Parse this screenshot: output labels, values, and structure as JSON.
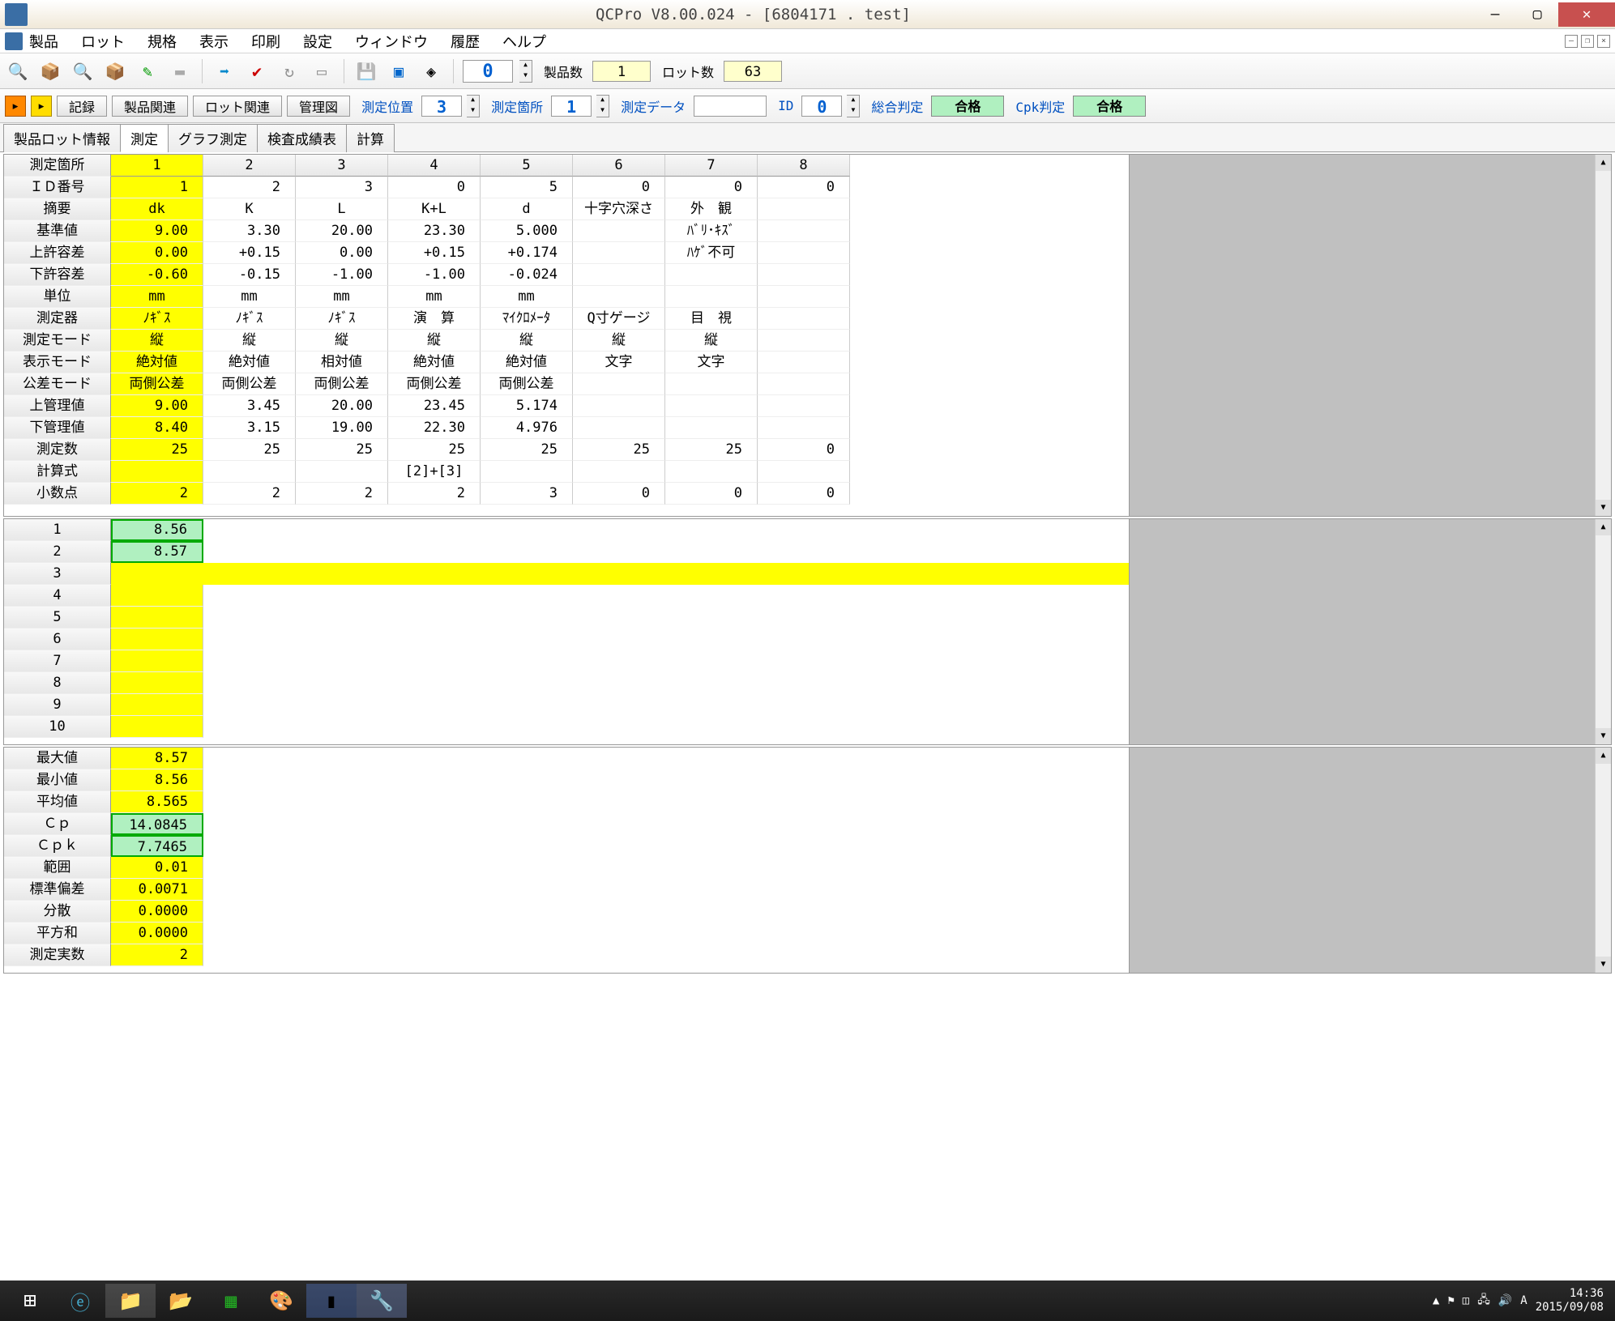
{
  "title": "QCPro V8.00.024 - [6804171  .  test]",
  "menu": [
    "製品",
    "ロット",
    "規格",
    "表示",
    "印刷",
    "設定",
    "ウィンドウ",
    "履歴",
    "ヘルプ"
  ],
  "toolbar1": {
    "counter": "0",
    "label_products": "製品数",
    "val_products": "1",
    "label_lots": "ロット数",
    "val_lots": "63"
  },
  "toolbar2": {
    "btns": [
      "記録",
      "製品関連",
      "ロット関連",
      "管理図"
    ],
    "lbl_pos": "測定位置",
    "val_pos": "3",
    "lbl_place": "測定箇所",
    "val_place": "1",
    "lbl_data": "測定データ",
    "lbl_id": "ID",
    "val_id": "0",
    "lbl_overall": "総合判定",
    "val_overall": "合格",
    "lbl_cpk": "Cpk判定",
    "val_cpk": "合格"
  },
  "tabs": [
    "製品ロット情報",
    "測定",
    "グラフ測定",
    "検査成績表",
    "計算"
  ],
  "spec": {
    "rowheaders": [
      "測定箇所",
      "ＩＤ番号",
      "摘要",
      "基準値",
      "上許容差",
      "下許容差",
      "単位",
      "測定器",
      "測定モード",
      "表示モード",
      "公差モード",
      "上管理値",
      "下管理値",
      "測定数",
      "計算式",
      "小数点"
    ],
    "cols": [
      [
        "1",
        "1",
        "dk",
        "9.00",
        "0.00",
        "-0.60",
        "mm",
        "ﾉｷﾞｽ",
        "縦",
        "絶対値",
        "両側公差",
        "9.00",
        "8.40",
        "25",
        "",
        "2"
      ],
      [
        "2",
        "2",
        "K",
        "3.30",
        "+0.15",
        "-0.15",
        "mm",
        "ﾉｷﾞｽ",
        "縦",
        "絶対値",
        "両側公差",
        "3.45",
        "3.15",
        "25",
        "",
        "2"
      ],
      [
        "3",
        "3",
        "L",
        "20.00",
        "0.00",
        "-1.00",
        "mm",
        "ﾉｷﾞｽ",
        "縦",
        "相対値",
        "両側公差",
        "20.00",
        "19.00",
        "25",
        "",
        "2"
      ],
      [
        "4",
        "0",
        "K+L",
        "23.30",
        "+0.15",
        "-1.00",
        "mm",
        "演　算",
        "縦",
        "絶対値",
        "両側公差",
        "23.45",
        "22.30",
        "25",
        "[2]+[3]",
        "2"
      ],
      [
        "5",
        "5",
        "d",
        "5.000",
        "+0.174",
        "-0.024",
        "mm",
        "ﾏｲｸﾛﾒｰﾀ",
        "縦",
        "絶対値",
        "両側公差",
        "5.174",
        "4.976",
        "25",
        "",
        "3"
      ],
      [
        "6",
        "0",
        "十字穴深さ",
        "",
        "",
        "",
        "",
        "Q寸ゲージ",
        "縦",
        "文字",
        "",
        "",
        "",
        "25",
        "",
        "0"
      ],
      [
        "7",
        "0",
        "外　観",
        "ﾊﾞﾘ･ｷｽﾞ",
        "ﾊｹﾞ不可",
        "",
        "",
        "目　視",
        "縦",
        "文字",
        "",
        "",
        "",
        "25",
        "",
        "0"
      ],
      [
        "8",
        "0",
        "",
        "",
        "",
        "",
        "",
        "",
        "",
        "",
        "",
        "",
        "",
        "0",
        "",
        "0"
      ]
    ]
  },
  "measurements": {
    "rows": [
      "1",
      "2",
      "3",
      "4",
      "5",
      "6",
      "7",
      "8",
      "9",
      "10"
    ],
    "values": {
      "1": "8.56",
      "2": "8.57"
    }
  },
  "stats": {
    "rows": [
      {
        "label": "最大値",
        "val": "8.57",
        "style": "yellow"
      },
      {
        "label": "最小値",
        "val": "8.56",
        "style": "yellow"
      },
      {
        "label": "平均値",
        "val": "8.565",
        "style": "yellow"
      },
      {
        "label": "Ｃｐ",
        "val": "14.0845",
        "style": "green"
      },
      {
        "label": "Ｃｐｋ",
        "val": "7.7465",
        "style": "green"
      },
      {
        "label": "範囲",
        "val": "0.01",
        "style": "yellow"
      },
      {
        "label": "標準偏差",
        "val": "0.0071",
        "style": "yellow"
      },
      {
        "label": "分散",
        "val": "0.0000",
        "style": "yellow"
      },
      {
        "label": "平方和",
        "val": "0.0000",
        "style": "yellow"
      },
      {
        "label": "測定実数",
        "val": "2",
        "style": "yellow"
      }
    ]
  },
  "taskbar": {
    "time": "14:36",
    "date": "2015/09/08"
  }
}
